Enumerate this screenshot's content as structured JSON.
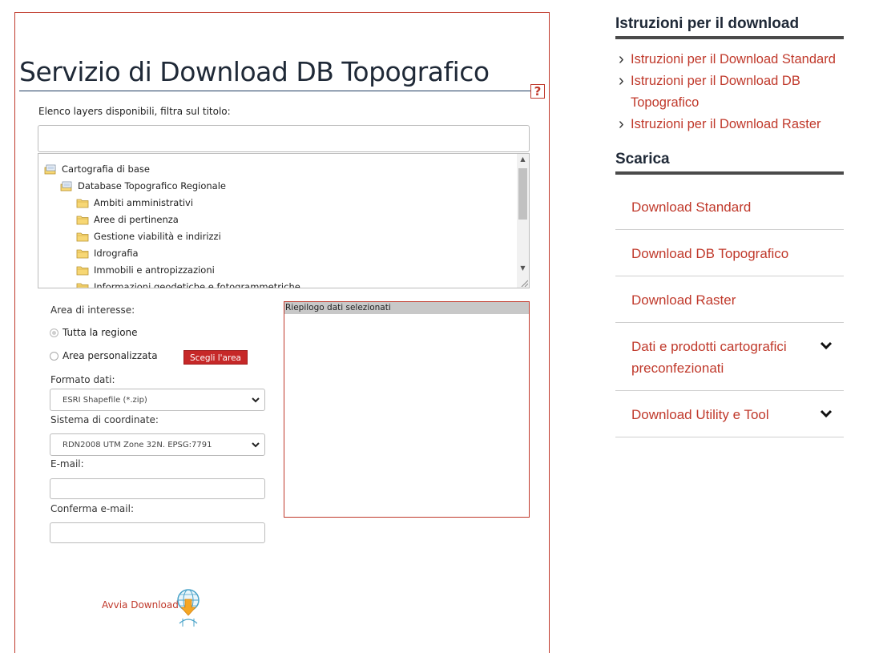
{
  "main": {
    "title": "Servizio di Download DB Topografico",
    "help_label": "?",
    "filter_label": "Elenco layers disponibili, filtra sul titolo:",
    "filter_value": "",
    "tree": [
      {
        "label": "Cartografia di base",
        "level": 0,
        "icon": "layer-stack-icon"
      },
      {
        "label": "Database Topografico Regionale",
        "level": 1,
        "icon": "layer-stack-icon"
      },
      {
        "label": "Ambiti amministrativi",
        "level": 2,
        "icon": "folder-icon"
      },
      {
        "label": "Aree di pertinenza",
        "level": 2,
        "icon": "folder-icon"
      },
      {
        "label": "Gestione viabilità e indirizzi",
        "level": 2,
        "icon": "folder-icon"
      },
      {
        "label": "Idrografia",
        "level": 2,
        "icon": "folder-icon"
      },
      {
        "label": "Immobili e antropizzazioni",
        "level": 2,
        "icon": "folder-icon"
      },
      {
        "label": "Informazioni geodetiche e fotogrammetriche",
        "level": 2,
        "icon": "folder-icon"
      }
    ],
    "area_label": "Area di interesse:",
    "radio_region": "Tutta la regione",
    "radio_custom": "Area personalizzata",
    "choose_area_label": "Scegli l'area",
    "format_label": "Formato dati:",
    "format_value": "ESRI Shapefile (*.zip)",
    "crs_label": "Sistema di coordinate:",
    "crs_value": "RDN2008 UTM Zone 32N. EPSG:7791",
    "email_label": "E-mail:",
    "confirm_email_label": "Conferma e-mail:",
    "summary_title": "Riepilogo dati selezionati",
    "download_label": "Avvia Download"
  },
  "sidebar": {
    "instructions_heading": "Istruzioni per il download",
    "instructions": [
      {
        "lines": [
          "Istruzioni per il Download Standard"
        ]
      },
      {
        "lines": [
          "Istruzioni per il Download DB",
          "Topografico"
        ]
      },
      {
        "lines": [
          "Istruzioni per il Download Raster"
        ]
      }
    ],
    "download_heading": "Scarica",
    "downloads": [
      {
        "lines": [
          "Download Standard"
        ],
        "expandable": false
      },
      {
        "lines": [
          "Download DB Topografico"
        ],
        "expandable": false
      },
      {
        "lines": [
          "Download Raster"
        ],
        "expandable": false
      },
      {
        "lines": [
          "Dati e prodotti cartografici",
          "preconfezionati"
        ],
        "expandable": true
      },
      {
        "lines": [
          "Download Utility e Tool"
        ],
        "expandable": true
      }
    ]
  },
  "colors": {
    "accent": "#c0392b",
    "button": "#c62828",
    "heading": "#1f2937"
  }
}
